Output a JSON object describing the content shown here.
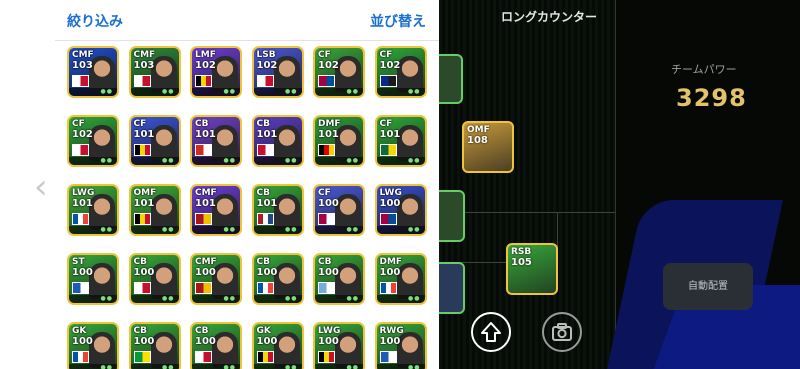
{
  "panel": {
    "filter_label": "絞り込み",
    "sort_label": "並び替え"
  },
  "player_cards": [
    {
      "pos": "CMF",
      "rating": "103",
      "bg": "#1f4fd1",
      "flag": [
        "#ffffff",
        "#c8102e"
      ]
    },
    {
      "pos": "CMF",
      "rating": "103",
      "bg": "#2e8b3a",
      "flag": [
        "#ffffff",
        "#c8102e"
      ]
    },
    {
      "pos": "LMF",
      "rating": "102",
      "bg": "#6b3fd6",
      "flag": [
        "#000000",
        "#f5d800",
        "#c8102e"
      ]
    },
    {
      "pos": "LSB",
      "rating": "102",
      "bg": "#4a57d8",
      "flag": [
        "#ffffff",
        "#c8102e"
      ]
    },
    {
      "pos": "CF",
      "rating": "102",
      "bg": "#3aa53a",
      "flag": [
        "#a50044",
        "#004d98"
      ]
    },
    {
      "pos": "CF",
      "rating": "102",
      "bg": "#2fa83a",
      "flag": [
        "#0a2a8a",
        "#1b1b1b"
      ]
    },
    {
      "pos": "CF",
      "rating": "102",
      "bg": "#2fa83a",
      "flag": [
        "#ffffff",
        "#c8102e"
      ]
    },
    {
      "pos": "CF",
      "rating": "101",
      "bg": "#3c55d8",
      "flag": [
        "#000000",
        "#f5d800",
        "#c8102e"
      ]
    },
    {
      "pos": "CB",
      "rating": "101",
      "bg": "#7042c8",
      "flag": [
        "#d52b1e",
        "#ffffff"
      ]
    },
    {
      "pos": "CB",
      "rating": "101",
      "bg": "#5c3fc4",
      "flag": [
        "#c8102e",
        "#ffffff"
      ]
    },
    {
      "pos": "DMF",
      "rating": "101",
      "bg": "#2f9f3a",
      "flag": [
        "#000000",
        "#dd0000",
        "#ffce00"
      ]
    },
    {
      "pos": "CF",
      "rating": "101",
      "bg": "#2fa83a",
      "flag": [
        "#0b6e3a",
        "#f5d800"
      ]
    },
    {
      "pos": "LWG",
      "rating": "101",
      "bg": "#3fae3a",
      "flag": [
        "#0055a4",
        "#ffffff",
        "#ef4135"
      ]
    },
    {
      "pos": "OMF",
      "rating": "101",
      "bg": "#3fae3a",
      "flag": [
        "#000000",
        "#f5d800",
        "#c8102e"
      ]
    },
    {
      "pos": "CMF",
      "rating": "101",
      "bg": "#6b3fd6",
      "flag": [
        "#aa151b",
        "#f1bf00"
      ]
    },
    {
      "pos": "CB",
      "rating": "101",
      "bg": "#37a83a",
      "flag": [
        "#ae1c28",
        "#ffffff",
        "#21468b"
      ]
    },
    {
      "pos": "CF",
      "rating": "100",
      "bg": "#4b5ad8",
      "flag": [
        "#a50044",
        "#ffffff"
      ]
    },
    {
      "pos": "LWG",
      "rating": "100",
      "bg": "#3a4fcf",
      "flag": [
        "#a50044",
        "#004d98"
      ]
    },
    {
      "pos": "ST",
      "rating": "100",
      "bg": "#37a83a",
      "flag": [
        "#1c5bb8",
        "#ffffff"
      ]
    },
    {
      "pos": "CB",
      "rating": "100",
      "bg": "#37a83a",
      "flag": [
        "#ffffff",
        "#c8102e"
      ]
    },
    {
      "pos": "CMF",
      "rating": "100",
      "bg": "#37a83a",
      "flag": [
        "#aa151b",
        "#f1bf00"
      ]
    },
    {
      "pos": "CB",
      "rating": "100",
      "bg": "#37a83a",
      "flag": [
        "#0055a4",
        "#ffffff",
        "#ef4135"
      ]
    },
    {
      "pos": "CB",
      "rating": "100",
      "bg": "#37a83a",
      "flag": [
        "#74acdf",
        "#ffffff"
      ]
    },
    {
      "pos": "DMF",
      "rating": "100",
      "bg": "#37a83a",
      "flag": [
        "#0055a4",
        "#ffffff",
        "#ef4135"
      ]
    },
    {
      "pos": "GK",
      "rating": "100",
      "bg": "#37a83a",
      "flag": [
        "#0055a4",
        "#ffffff",
        "#ef4135"
      ]
    },
    {
      "pos": "CB",
      "rating": "100",
      "bg": "#37a83a",
      "flag": [
        "#009c3b",
        "#ffdf00"
      ]
    },
    {
      "pos": "CB",
      "rating": "100",
      "bg": "#37a83a",
      "flag": [
        "#ffffff",
        "#c8102e"
      ]
    },
    {
      "pos": "GK",
      "rating": "100",
      "bg": "#37a83a",
      "flag": [
        "#000000",
        "#f5d800",
        "#c8102e"
      ]
    },
    {
      "pos": "LWG",
      "rating": "100",
      "bg": "#37a83a",
      "flag": [
        "#000000",
        "#f5d800",
        "#c8102e"
      ]
    },
    {
      "pos": "RWG",
      "rating": "100",
      "bg": "#37a83a",
      "flag": [
        "#1c5bb8",
        "#ffffff"
      ]
    }
  ],
  "formation": {
    "tactic_label": "ロングカウンター",
    "team_power_label": "チームパワー",
    "team_power_value": "3298",
    "auto_arrange_label": "自動配置",
    "pitch_cards": [
      {
        "pos": "OMF",
        "rating": "108",
        "bg": "#c79a3a"
      },
      {
        "pos": "RSB",
        "rating": "105",
        "bg": "#37a83a"
      }
    ]
  },
  "icons": {
    "back": "chevron-left-icon",
    "upload": "arrow-up-circle-icon",
    "camera": "camera-icon"
  }
}
